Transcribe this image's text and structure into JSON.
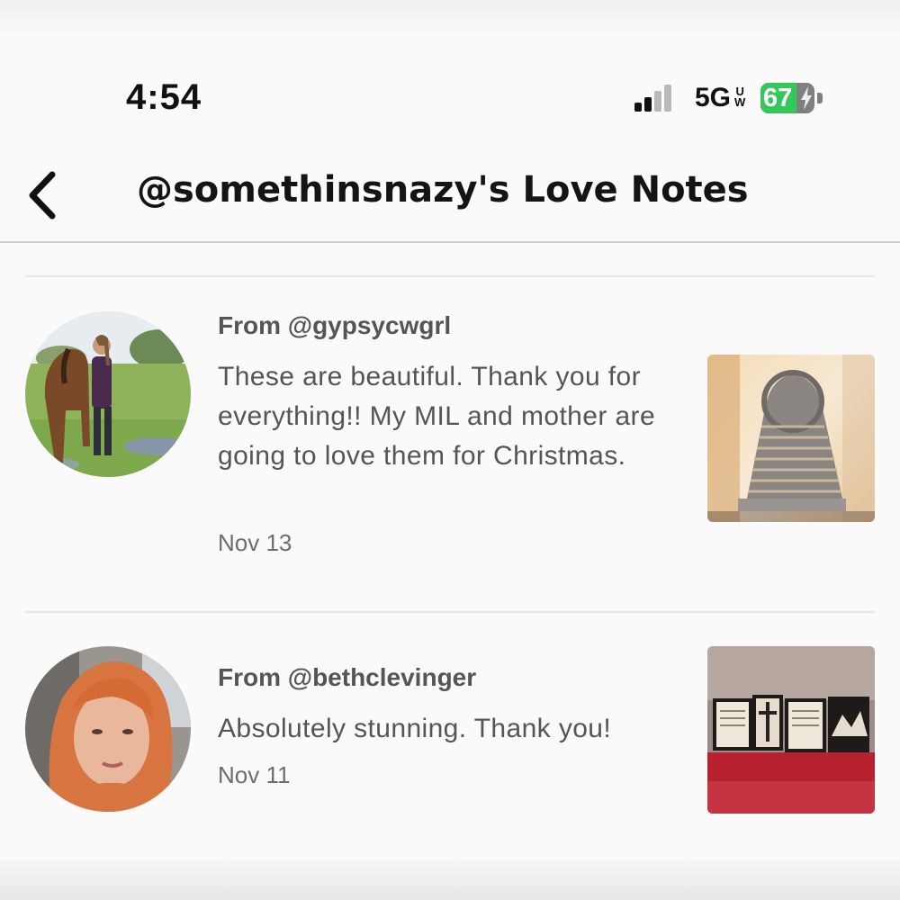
{
  "status_bar": {
    "time": "4:54",
    "network": "5G",
    "network_sub": "UW",
    "battery_percent": 67,
    "battery_label": "67",
    "signal_bars_active": 2,
    "signal_bars_total": 4,
    "charging": true
  },
  "header": {
    "title": "@somethinsnazy's Love Notes",
    "back_icon": "chevron-left-icon"
  },
  "notes": [
    {
      "from": "From @gypsycwgrl",
      "message": "These are beautiful. Thank you for everything!! My MIL and mother are going to love them for Christmas.",
      "date": "Nov 13"
    },
    {
      "from": "From @bethclevinger",
      "message": "Absolutely stunning. Thank you!",
      "date": "Nov 11"
    }
  ],
  "colors": {
    "battery_green": "#34c759",
    "background": "#fbfafb",
    "secondary_text": "#555555"
  }
}
